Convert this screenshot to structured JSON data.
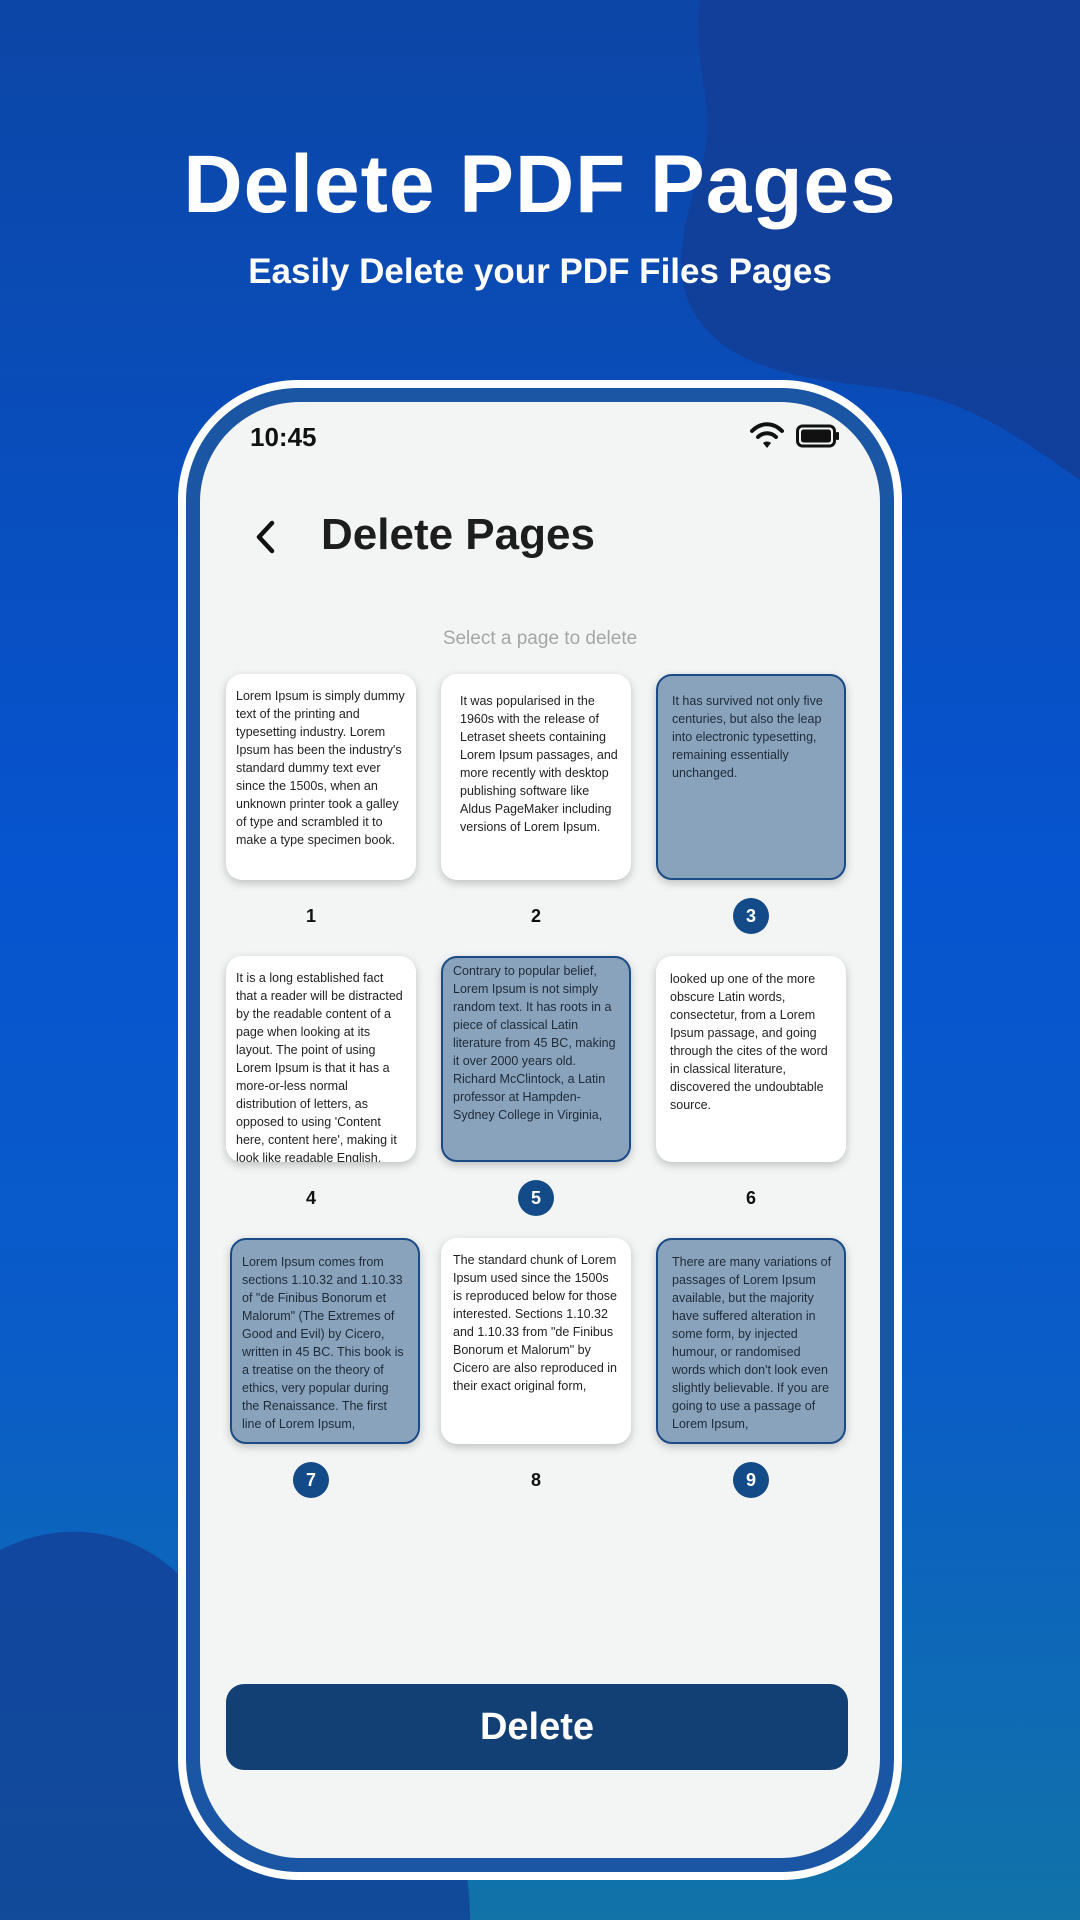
{
  "hero": {
    "title": "Delete PDF Pages",
    "subtitle": "Easily Delete your PDF Files Pages"
  },
  "status_bar": {
    "time": "10:45",
    "icons": [
      "wifi-icon",
      "battery-icon"
    ]
  },
  "header": {
    "back_icon": "chevron-left-icon",
    "title": "Delete Pages"
  },
  "hint": "Select a page to delete",
  "pages": [
    {
      "number": "1",
      "selected": false,
      "text": "Lorem Ipsum is simply dummy text of the printing and typesetting industry. Lorem Ipsum has been the industry's standard dummy text ever since the 1500s, when an unknown printer took a galley of type and scrambled it to make a type specimen book."
    },
    {
      "number": "2",
      "selected": false,
      "text": "It was popularised in the 1960s with the release of Letraset sheets containing Lorem Ipsum passages, and more recently with desktop publishing software like Aldus PageMaker including versions of Lorem Ipsum."
    },
    {
      "number": "3",
      "selected": true,
      "text": "It has survived not only five centuries, but also the leap into electronic typesetting, remaining essentially unchanged."
    },
    {
      "number": "4",
      "selected": false,
      "text": "It is a long established fact that a reader will be distracted by the readable content of a page when looking at its layout. The point of using Lorem Ipsum is that it has a more-or-less normal distribution of letters, as opposed to using 'Content here, content here', making it look like readable English."
    },
    {
      "number": "5",
      "selected": true,
      "text": "Contrary to popular belief, Lorem Ipsum is not simply random text. It has roots in a piece of classical Latin literature from 45 BC, making it over 2000 years old. Richard McClintock, a Latin professor at Hampden-Sydney College in Virginia,"
    },
    {
      "number": "6",
      "selected": false,
      "text": "looked up one of the more obscure Latin words, consectetur, from a Lorem Ipsum passage, and going through the cites of the word in classical literature, discovered the undoubtable source."
    },
    {
      "number": "7",
      "selected": true,
      "text": "Lorem Ipsum comes from sections 1.10.32 and 1.10.33 of \"de Finibus Bonorum et Malorum\" (The Extremes of Good and Evil) by Cicero, written in 45 BC. This book is a treatise on the theory of ethics, very popular during the Renaissance. The first line of Lorem Ipsum,"
    },
    {
      "number": "8",
      "selected": false,
      "text": "The standard chunk of Lorem Ipsum used since the 1500s is reproduced below for those interested. Sections 1.10.32 and 1.10.33 from \"de Finibus Bonorum et Malorum\" by Cicero are also reproduced in their exact original form,"
    },
    {
      "number": "9",
      "selected": true,
      "text": "There are many variations of passages of Lorem Ipsum available, but the majority have suffered alteration in some form, by injected humour, or randomised words which don't look even slightly believable. If you are going to use a passage of Lorem Ipsum,"
    }
  ],
  "delete_button": "Delete",
  "colors": {
    "accent": "#123f74",
    "selected_card": "#8aa3bd",
    "selected_badge": "#134a88"
  }
}
